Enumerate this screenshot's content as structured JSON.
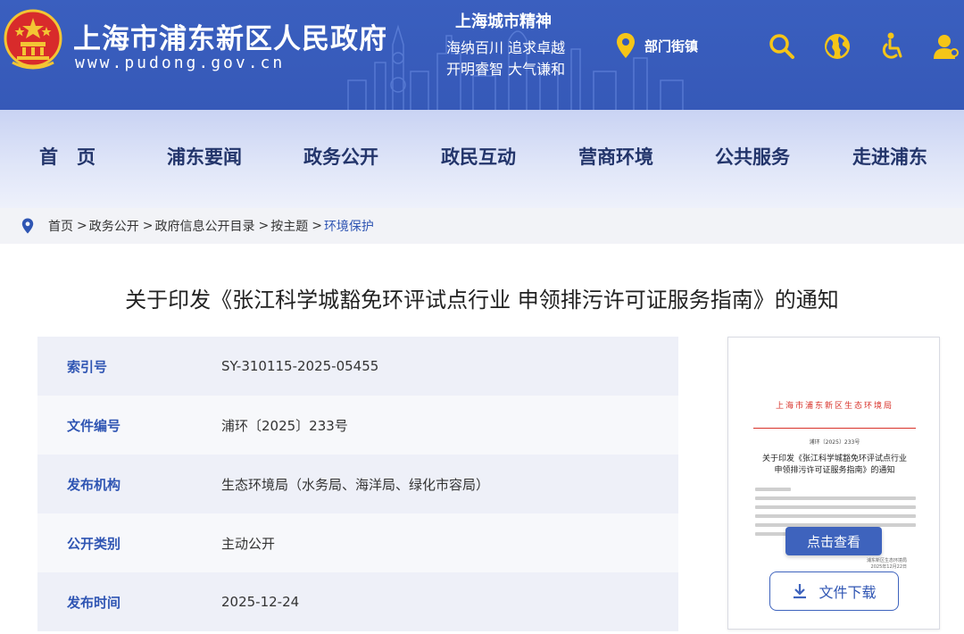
{
  "header": {
    "site_title": "上海市浦东新区人民政府",
    "site_url": "www.pudong.gov.cn",
    "spirit_title": "上海城市精神",
    "spirit_line1": "海纳百川  追求卓越",
    "spirit_line2": "开明睿智  大气谦和",
    "dept_link": "部门街镇",
    "icons": [
      "location-pin-icon",
      "search-icon",
      "globe-icon",
      "accessibility-icon",
      "user-icon"
    ]
  },
  "nav": {
    "items": [
      "首　页",
      "浦东要闻",
      "政务公开",
      "政民互动",
      "营商环境",
      "公共服务",
      "走进浦东"
    ]
  },
  "breadcrumb": {
    "items": [
      "首页",
      "政务公开",
      "政府信息公开目录",
      "按主题",
      "环境保护"
    ],
    "separator": ">"
  },
  "article": {
    "title": "关于印发《张江科学城豁免环评试点行业 申领排污许可证服务指南》的通知"
  },
  "meta": [
    {
      "label": "索引号",
      "value": "SY-310115-2025-05455"
    },
    {
      "label": "文件编号",
      "value": "浦环〔2025〕233号"
    },
    {
      "label": "发布机构",
      "value": "生态环境局（水务局、海洋局、绿化市容局）"
    },
    {
      "label": "公开类别",
      "value": "主动公开"
    },
    {
      "label": "发布时间",
      "value": "2025-12-24"
    }
  ],
  "preview": {
    "issuer": "上海市浦东新区生态环境局",
    "doc_number": "浦环〔2025〕233号",
    "doc_title_line1": "关于印发《张江科学城豁免环评试点行业",
    "doc_title_line2": "申领排污许可证服务指南》的通知",
    "sign_org": "浦东新区生态环境局",
    "sign_date": "2025年12月22日",
    "view_button": "点击查看",
    "download_button": "文件下载"
  },
  "colors": {
    "header_bg": "#3659b8",
    "accent_blue": "#2f55b3",
    "nav_text": "#23356b",
    "icon_yellow": "#f5c518",
    "issuer_red": "#d8322a"
  }
}
